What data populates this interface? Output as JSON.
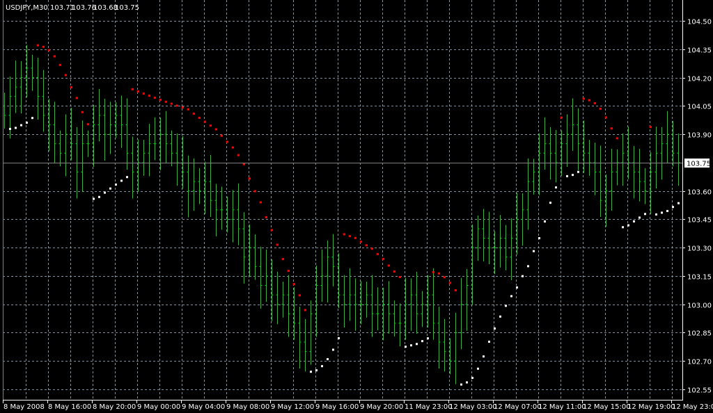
{
  "chart_data": {
    "type": "ohlc",
    "title": "USDJPY,M30",
    "ohlc_header": [
      "103.71",
      "103.76",
      "103.68",
      "103.75"
    ],
    "current_price": 103.75,
    "current_price_label": "103.75",
    "ylim": [
      102.48,
      104.61
    ],
    "y_ticks": [
      "104.50",
      "104.35",
      "104.20",
      "104.05",
      "103.90",
      "103.60",
      "103.45",
      "103.30",
      "103.15",
      "103.00",
      "102.85",
      "102.70",
      "102.55"
    ],
    "x_ticks": [
      "8 May 2008",
      "8 May 16:00",
      "8 May 20:00",
      "9 May 00:00",
      "9 May 04:00",
      "9 May 08:00",
      "9 May 12:00",
      "9 May 16:00",
      "9 May 20:00",
      "11 May 23:00",
      "12 May 03:00",
      "12 May 07:00",
      "12 May 11:00",
      "12 May 15:00",
      "12 May 19:00",
      "12 May 23:00"
    ],
    "bars_per_tick": 8,
    "grid": true,
    "wick": 0.07,
    "close": [
      104.0,
      104.1,
      104.15,
      104.2,
      104.25,
      104.2,
      104.1,
      104.0,
      103.95,
      103.85,
      103.8,
      103.9,
      103.85,
      103.7,
      103.85,
      103.85,
      103.95,
      104.0,
      103.9,
      103.95,
      104.0,
      103.95,
      103.8,
      103.7,
      103.75,
      103.8,
      103.85,
      103.85,
      103.9,
      103.85,
      103.8,
      103.75,
      103.7,
      103.6,
      103.65,
      103.6,
      103.65,
      103.55,
      103.5,
      103.5,
      103.45,
      103.5,
      103.4,
      103.25,
      103.3,
      103.2,
      103.1,
      103.15,
      103.05,
      103.0,
      103.05,
      102.95,
      102.9,
      102.8,
      102.75,
      102.95,
      103.1,
      103.15,
      103.25,
      103.2,
      103.05,
      103.0,
      103.05,
      103.0,
      103.0,
      103.05,
      102.95,
      102.95,
      103.0,
      102.95,
      102.9,
      102.9,
      103.0,
      103.05,
      102.95,
      103.0,
      103.05,
      102.9,
      102.8,
      102.75,
      102.7,
      102.85,
      103.0,
      103.1,
      103.3,
      103.4,
      103.35,
      103.3,
      103.3,
      103.35,
      103.25,
      103.35,
      103.45,
      103.5,
      103.65,
      103.7,
      103.8,
      103.85,
      103.8,
      103.75,
      103.85,
      103.9,
      103.95,
      103.85,
      103.8,
      103.75,
      103.7,
      103.55,
      103.6,
      103.7,
      103.75,
      103.8,
      103.75,
      103.7,
      103.65,
      103.6,
      103.7,
      103.8,
      103.85,
      103.9,
      103.8,
      103.75
    ],
    "sar_step": 0.02,
    "sar_max": 0.2,
    "colors": {
      "bar": "#00dd00",
      "grid": "#8090a0",
      "sar_up": "#ffffff",
      "sar_down": "#ff0000",
      "price_line": "#808080",
      "axis": "#ffffff"
    }
  }
}
